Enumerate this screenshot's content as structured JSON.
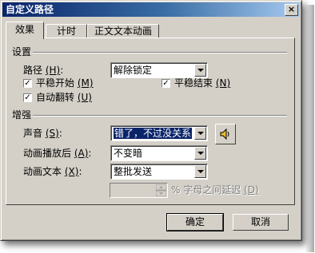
{
  "window": {
    "title": "自定义路径",
    "close_glyph": "×"
  },
  "tabs": [
    "效果",
    "计时",
    "正文文本动画"
  ],
  "settings": {
    "group_label": "设置",
    "path_label": "路径",
    "path_hotkey": "(H)",
    "path_value": "解除锁定",
    "smooth_start": {
      "label": "平稳开始",
      "hotkey": "(M)",
      "checked": true
    },
    "smooth_end": {
      "label": "平稳结束",
      "hotkey": "(N)",
      "checked": true
    },
    "auto_reverse": {
      "label": "自动翻转",
      "hotkey": "(U)",
      "checked": true
    }
  },
  "enhance": {
    "group_label": "增强",
    "sound_label": "声音",
    "sound_hotkey": "(S)",
    "sound_value": "错了，不过没关系",
    "after_anim_label": "动画播放后",
    "after_anim_hotkey": "(A)",
    "after_anim_value": "不变暗",
    "anim_text_label": "动画文本",
    "anim_text_hotkey": "(X)",
    "anim_text_value": "整批发送",
    "delay_label": "% 字母之间延迟",
    "delay_hotkey": "(D)"
  },
  "buttons": {
    "ok": "确定",
    "cancel": "取消"
  },
  "icons": {
    "speaker": "speaker-icon"
  },
  "colors": {
    "title_start": "#0a246a",
    "title_end": "#a6caf0",
    "face": "#d4d0c8",
    "selection": "#0a246a"
  }
}
